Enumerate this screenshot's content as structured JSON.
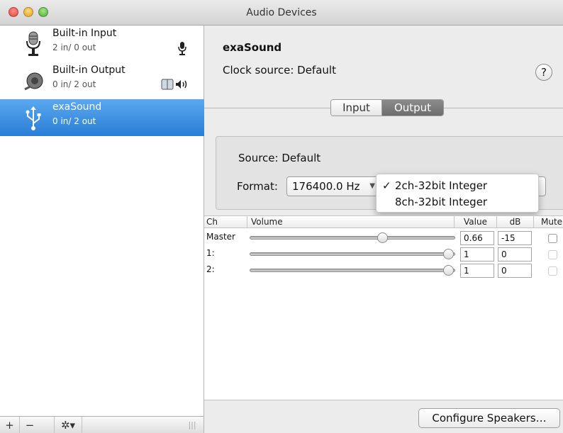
{
  "window": {
    "title": "Audio Devices"
  },
  "devices": [
    {
      "name": "Built-in Input",
      "channels": "2 in/ 0 out",
      "icon": "microphone-icon",
      "badge": "🎙"
    },
    {
      "name": "Built-in Output",
      "channels": "0 in/ 2 out",
      "icon": "speaker-icon",
      "badge": "◀)"
    },
    {
      "name": "exaSound",
      "channels": "0 in/ 2 out",
      "icon": "usb-icon"
    }
  ],
  "sidebar_toolbar": {
    "add": "+",
    "remove": "−",
    "gear": "✲▾",
    "grip": "|||"
  },
  "detail": {
    "device_name": "exaSound",
    "clock_label": "Clock source: Default",
    "help": "?",
    "tabs": [
      {
        "label": "Input"
      },
      {
        "label": "Output"
      }
    ],
    "source": "Source: Default",
    "format_label": "Format:",
    "format_rate": "176400.0 Hz",
    "format_menu": [
      {
        "label": "2ch-32bit Integer",
        "checked": "✓"
      },
      {
        "label": "8ch-32bit Integer",
        "checked": ""
      }
    ]
  },
  "volume_table": {
    "headers": {
      "ch": "Ch",
      "volume": "Volume",
      "value": "Value",
      "db": "dB",
      "mute": "Mute"
    },
    "rows": [
      {
        "ch": "Master",
        "value": "0.66",
        "db": "-15",
        "level": 0.66,
        "mute_enabled": true
      },
      {
        "ch": "1:",
        "value": "1",
        "db": "0",
        "level": 1,
        "mute_enabled": false
      },
      {
        "ch": "2:",
        "value": "1",
        "db": "0",
        "level": 1,
        "mute_enabled": false
      }
    ]
  },
  "configure_button": "Configure Speakers…",
  "colors": {
    "selection": "#2a7ed7",
    "window_bg": "#ececec"
  }
}
